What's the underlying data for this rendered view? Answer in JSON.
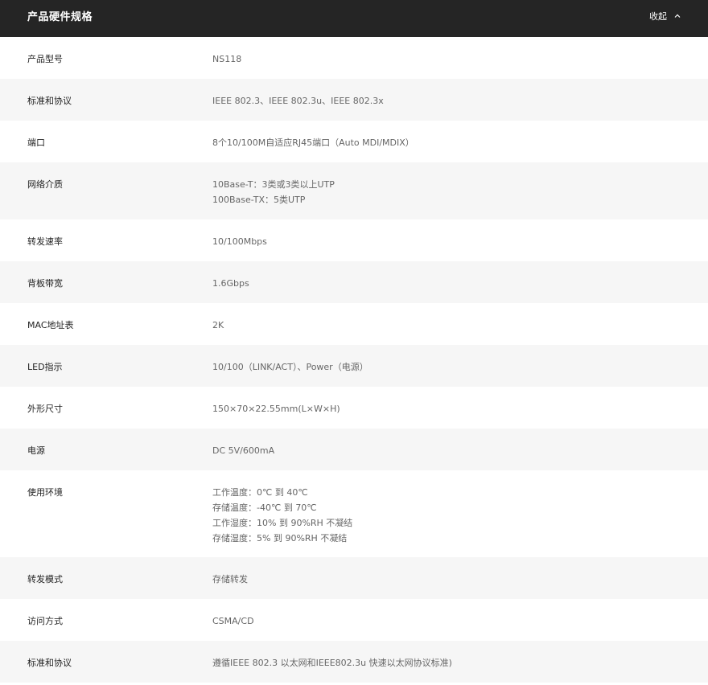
{
  "header": {
    "title": "产品硬件规格",
    "collapse_label": "收起"
  },
  "specs": [
    {
      "label": "产品型号",
      "lines": [
        "NS118"
      ]
    },
    {
      "label": "标准和协议",
      "lines": [
        "IEEE 802.3、IEEE 802.3u、IEEE 802.3x"
      ]
    },
    {
      "label": "端口",
      "lines": [
        "8个10/100M自适应RJ45端口（Auto MDI/MDIX）"
      ]
    },
    {
      "label": "网络介质",
      "lines": [
        "10Base-T：3类或3类以上UTP",
        "100Base-TX：5类UTP"
      ]
    },
    {
      "label": "转发速率",
      "lines": [
        "10/100Mbps"
      ]
    },
    {
      "label": "背板带宽",
      "lines": [
        "1.6Gbps"
      ]
    },
    {
      "label": "MAC地址表",
      "lines": [
        "2K"
      ]
    },
    {
      "label": "LED指示",
      "lines": [
        "10/100（LINK/ACT）、Power（电源）"
      ]
    },
    {
      "label": "外形尺寸",
      "lines": [
        "150×70×22.55mm(L×W×H)"
      ]
    },
    {
      "label": "电源",
      "lines": [
        "DC 5V/600mA"
      ]
    },
    {
      "label": "使用环境",
      "lines": [
        "工作温度：0℃ 到 40℃",
        "存储温度：-40℃ 到 70℃",
        "工作湿度：10% 到 90%RH 不凝结",
        "存储湿度：5% 到 90%RH 不凝结"
      ]
    },
    {
      "label": "转发模式",
      "lines": [
        "存储转发"
      ]
    },
    {
      "label": "访问方式",
      "lines": [
        "CSMA/CD"
      ]
    },
    {
      "label": "标准和协议",
      "lines": [
        "遵循IEEE 802.3 以太网和IEEE802.3u 快速以太网协议标准)"
      ]
    }
  ]
}
